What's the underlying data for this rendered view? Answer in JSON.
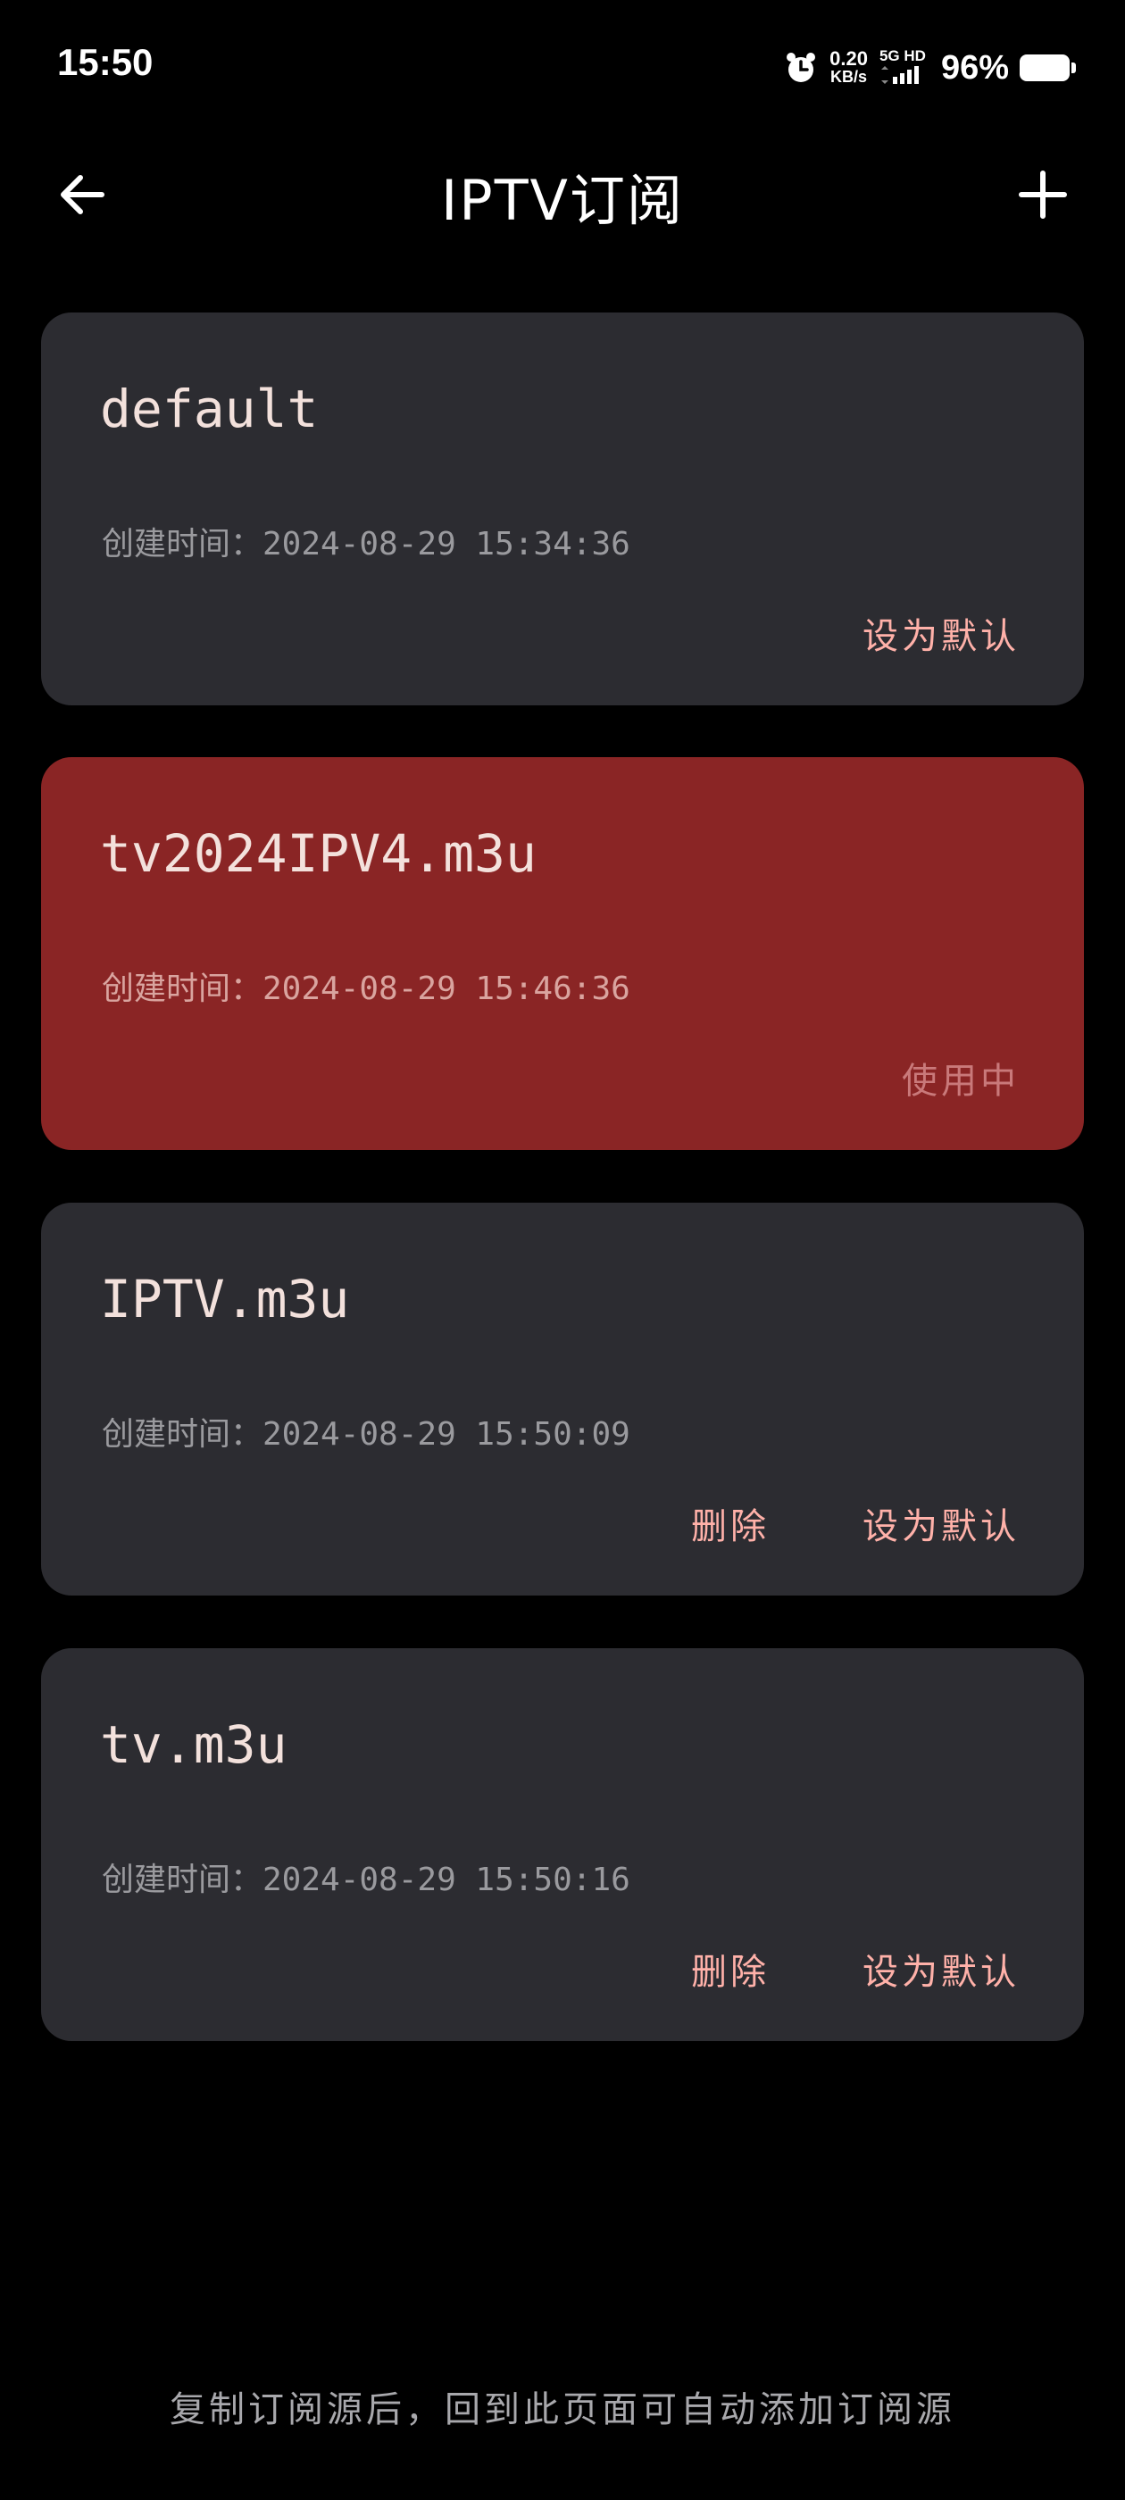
{
  "status_bar": {
    "time": "15:50",
    "net_speed_value": "0.20",
    "net_speed_unit": "KB/s",
    "network_label": "5G HD",
    "battery": "96%"
  },
  "header": {
    "title": "IPTV订阅",
    "back_icon": "arrow-left-icon",
    "add_icon": "plus-icon"
  },
  "subscriptions": [
    {
      "name": "default",
      "created": "创建时间：2024-08-29 15:34:36",
      "actions": [
        "设为默认"
      ],
      "active": false
    },
    {
      "name": "tv2024IPV4.m3u",
      "created": "创建时间：2024-08-29 15:46:36",
      "actions": [
        "使用中"
      ],
      "active": true
    },
    {
      "name": "IPTV.m3u",
      "created": "创建时间：2024-08-29 15:50:09",
      "actions": [
        "删除",
        "设为默认"
      ],
      "active": false
    },
    {
      "name": "tv.m3u",
      "created": "创建时间：2024-08-29 15:50:16",
      "actions": [
        "删除",
        "设为默认"
      ],
      "active": false
    }
  ],
  "footer_hint": "复制订阅源后，回到此页面可自动添加订阅源",
  "colors": {
    "background": "#000000",
    "card": "#2c2c31",
    "card_active": "#8a2525",
    "action_text": "#ffb1a9"
  }
}
